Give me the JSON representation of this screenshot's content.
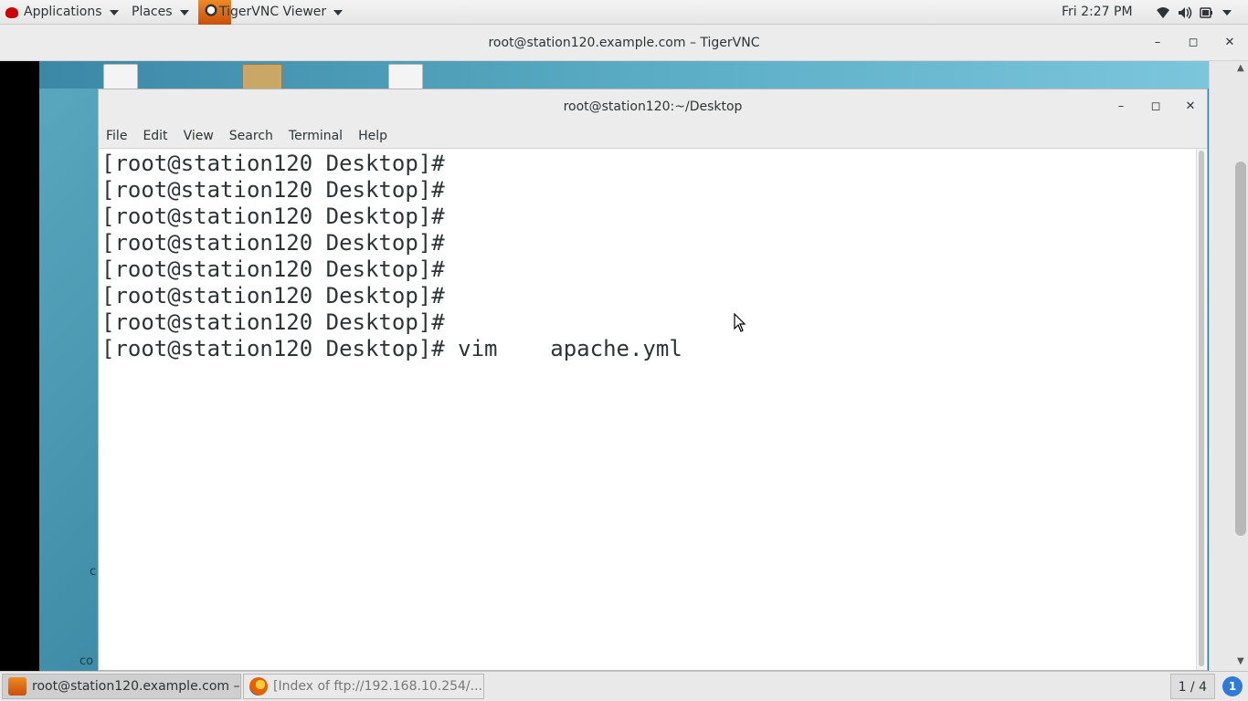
{
  "topbar": {
    "applications": "Applications",
    "places": "Places",
    "active_app": "TigerVNC Viewer",
    "clock": "Fri  2:27 PM"
  },
  "vnc_window": {
    "title": "root@station120.example.com – TigerVNC",
    "minimize": "–",
    "maximize": "◻",
    "close": "✕"
  },
  "remote_desktop": {
    "label_c1": "c",
    "label_c2": "co"
  },
  "terminal": {
    "title": "root@station120:~/Desktop",
    "minimize": "–",
    "maximize": "◻",
    "close": "✕",
    "menu": [
      "File",
      "Edit",
      "View",
      "Search",
      "Terminal",
      "Help"
    ],
    "lines": [
      "[root@station120 Desktop]#",
      "[root@station120 Desktop]#",
      "[root@station120 Desktop]#",
      "[root@station120 Desktop]#",
      "[root@station120 Desktop]#",
      "[root@station120 Desktop]#",
      "[root@station120 Desktop]#",
      "[root@station120 Desktop]# vim    apache.yml"
    ]
  },
  "taskbar": {
    "task1": "root@station120.example.com – ...",
    "task2": "[Index of ftp://192.168.10.254/...",
    "pager": "1 / 4",
    "notifications": "1"
  },
  "colors": {
    "accent": "#2f7ad8",
    "desktop": "#3d8aa6"
  }
}
